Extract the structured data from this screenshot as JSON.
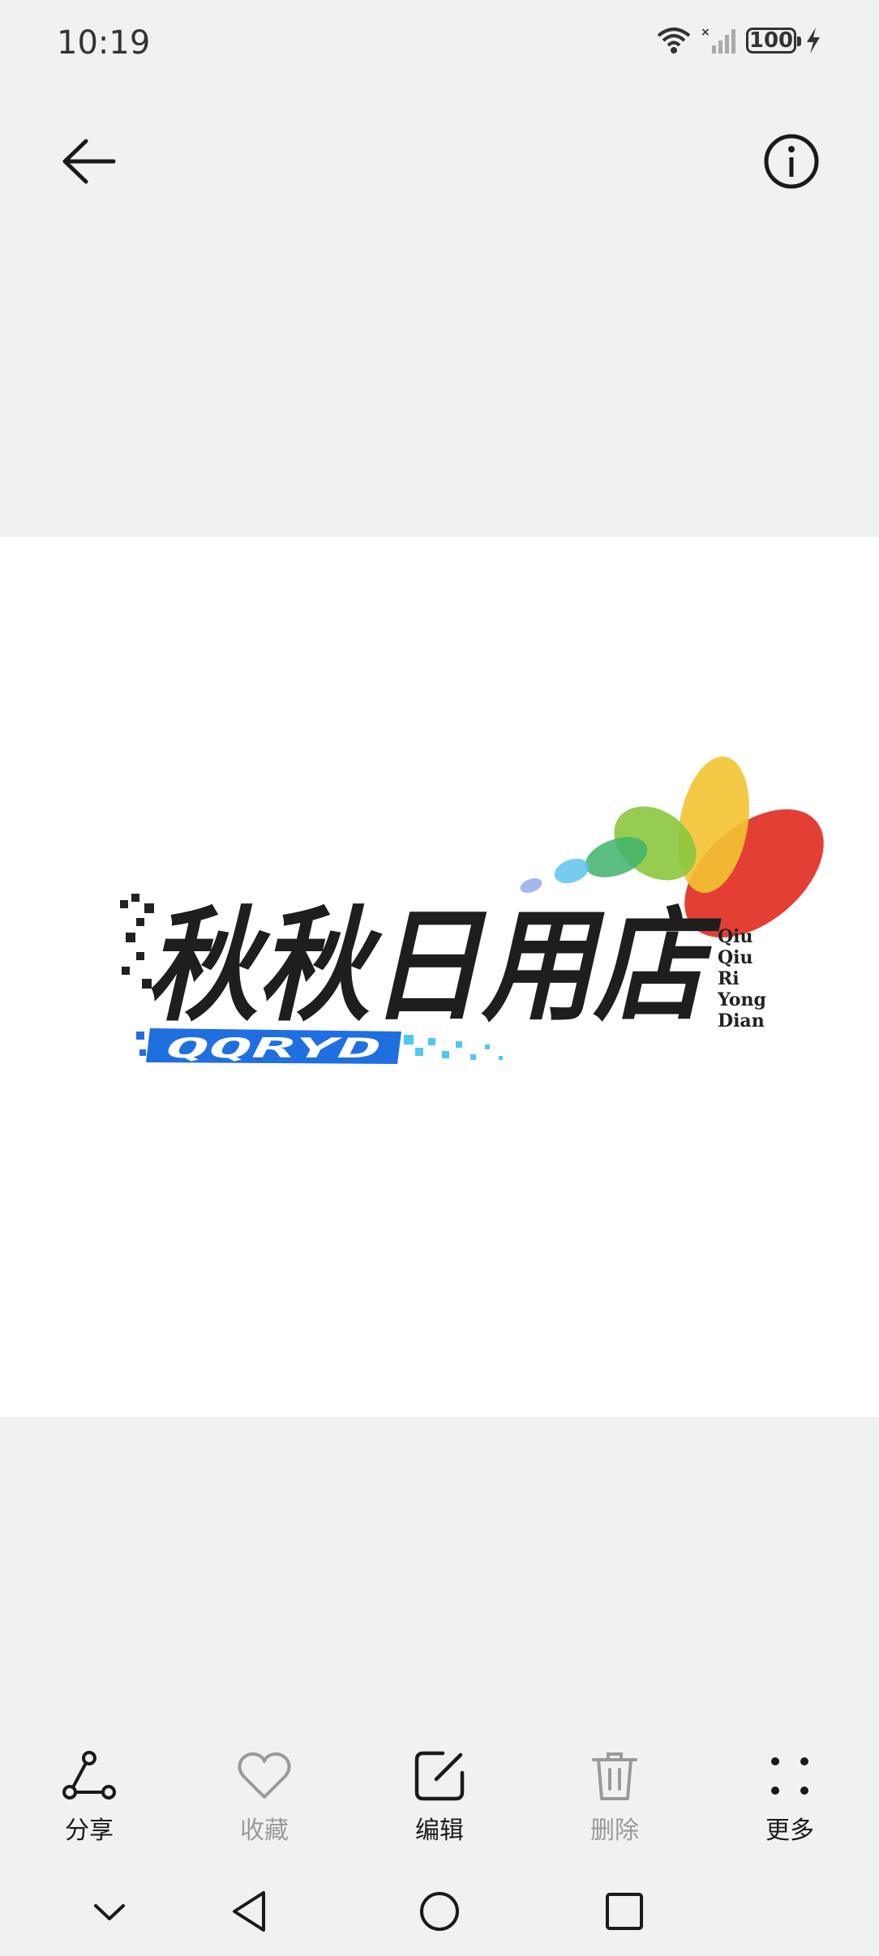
{
  "status_bar": {
    "time": "10:19",
    "battery": "100",
    "icons": [
      "wifi-icon",
      "signal-icon",
      "battery-icon",
      "charging-icon"
    ]
  },
  "top_bar": {
    "icons": [
      "back-arrow-icon",
      "info-icon"
    ]
  },
  "image": {
    "logo_title": "秋秋日用店",
    "logo_pinyin": [
      "Qiu",
      "Qiu",
      "Ri",
      "Yong",
      "Dian"
    ],
    "logo_banner": "QQRYD",
    "colors": {
      "red": "#e2352a",
      "yellow": "#f2c332",
      "green": "#8cc63f",
      "blue": "#1f6fe0",
      "cyan": "#4fc8ee"
    }
  },
  "toolbar": {
    "share_label": "分享",
    "favorite_label": "收藏",
    "edit_label": "编辑",
    "delete_label": "删除",
    "more_label": "更多"
  },
  "colors": {
    "background": "#f0f1f3",
    "image_background": "#ffffff",
    "active_text": "#1a1a1a",
    "disabled_text": "#9a9a9a"
  }
}
